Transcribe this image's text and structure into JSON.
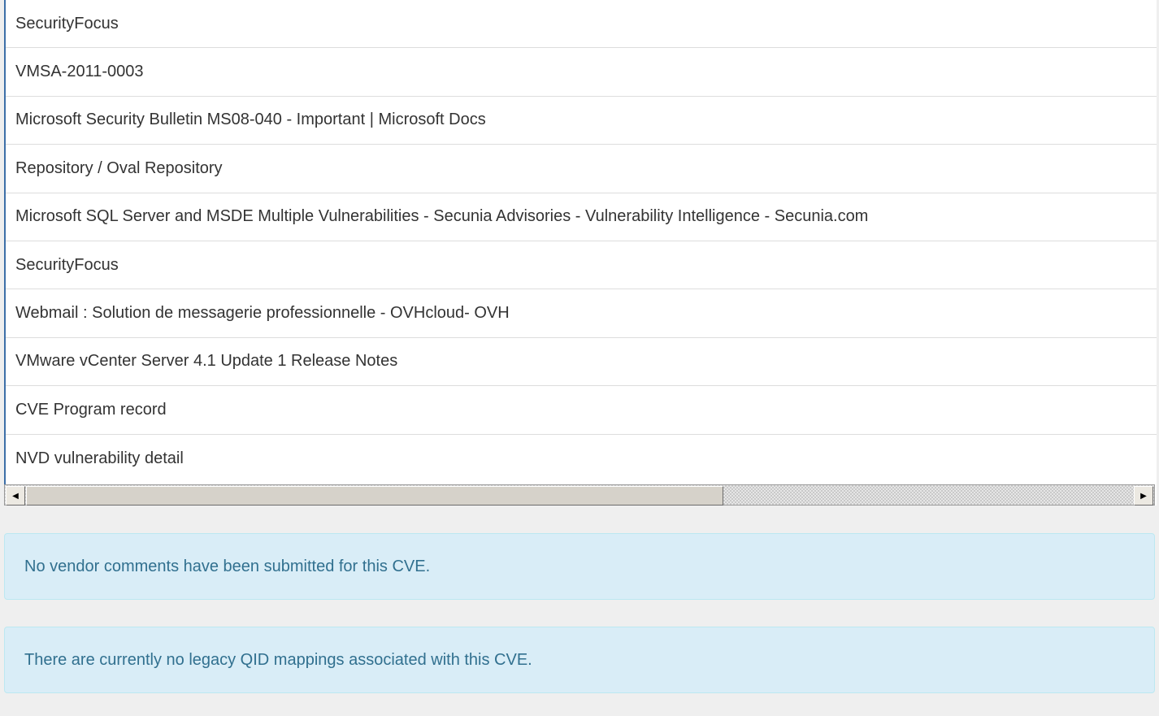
{
  "references": [
    "SecurityFocus",
    "VMSA-2011-0003",
    "Microsoft Security Bulletin MS08-040 - Important | Microsoft Docs",
    "Repository / Oval Repository",
    "Microsoft SQL Server and MSDE Multiple Vulnerabilities - Secunia Advisories - Vulnerability Intelligence - Secunia.com",
    "SecurityFocus",
    "Webmail : Solution de messagerie professionnelle - OVHcloud- OVH",
    "VMware vCenter Server 4.1 Update 1 Release Notes",
    "CVE Program record",
    "NVD vulnerability detail"
  ],
  "scrollbar": {
    "left_arrow": "◀",
    "right_arrow": "▶",
    "thumb_fraction": 0.63
  },
  "notices": {
    "vendor_comments": "No vendor comments have been submitted for this CVE.",
    "qid_mappings": "There are currently no legacy QID mappings associated with this CVE."
  },
  "colors": {
    "notice_bg": "#d9edf7",
    "notice_text": "#31708f",
    "accent_border": "#3d6fa8"
  }
}
